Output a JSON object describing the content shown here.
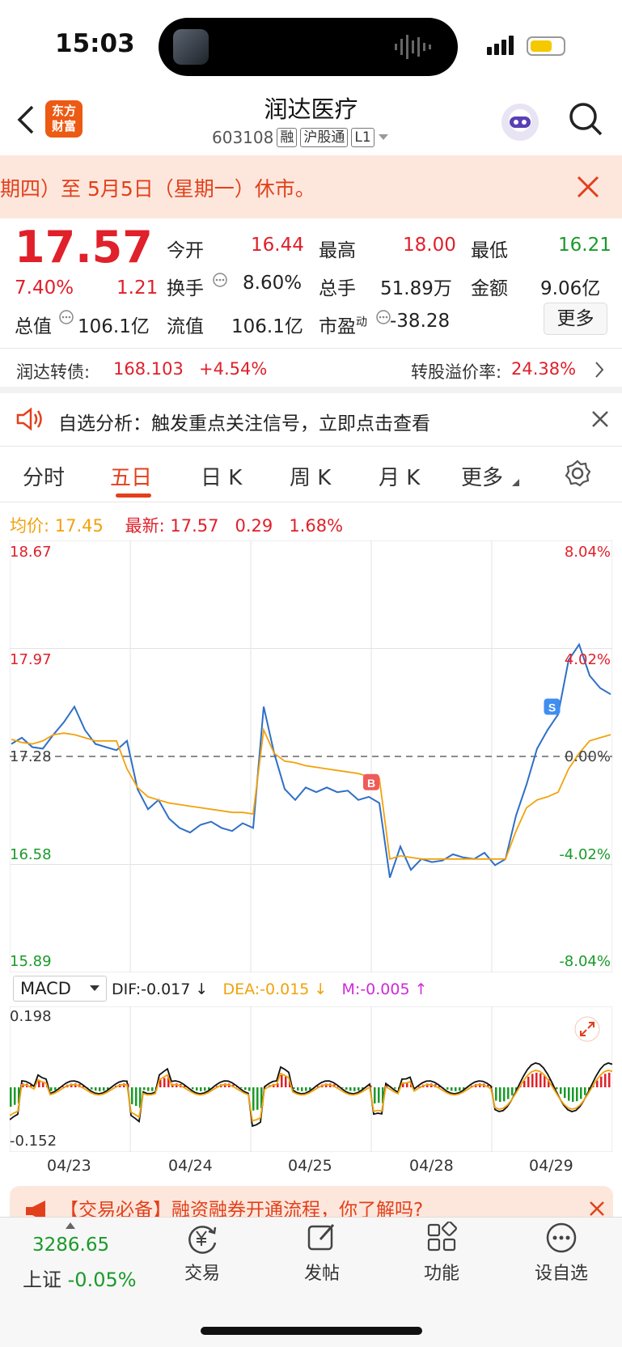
{
  "status": {
    "time": "15:03"
  },
  "header": {
    "logo": "东方\n财富",
    "title": "润达医疗",
    "code": "603108",
    "tags": [
      "融",
      "沪股通",
      "L1"
    ]
  },
  "notice": {
    "text": "期四）至 5月5日（星期一）休市。"
  },
  "quote": {
    "price": "17.57",
    "change_pct": "7.40%",
    "change": "1.21",
    "open_label": "今开",
    "open": "16.44",
    "high_label": "最高",
    "high": "18.00",
    "low_label": "最低",
    "low": "16.21",
    "turnover_label": "换手",
    "turnover": "8.60%",
    "volume_label": "总手",
    "volume": "51.89万",
    "amount_label": "金额",
    "amount": "9.06亿",
    "mktcap_label": "总值",
    "mktcap": "106.1亿",
    "float_label": "流值",
    "float": "106.1亿",
    "pe_label": "市盈",
    "pe_sup": "动",
    "pe": "-38.28",
    "more": "更多"
  },
  "bond": {
    "name": "润达转债:",
    "price": "168.103",
    "change": "+4.54%",
    "premium_label": "转股溢价率:",
    "premium": "24.38%"
  },
  "analysis": {
    "text": "自选分析：触发重点关注信号，立即点击查看"
  },
  "tabs": [
    "分时",
    "五日",
    "日 K",
    "周 K",
    "月 K",
    "更多"
  ],
  "chart_legend": {
    "avg_label": "均价:",
    "avg": "17.45",
    "latest_label": "最新:",
    "latest": "17.57",
    "chg": "0.29",
    "chg_pct": "1.68%"
  },
  "chart_data": {
    "type": "line",
    "title": "",
    "days": [
      "04/23",
      "04/24",
      "04/25",
      "04/28",
      "04/29"
    ],
    "ylim": [
      15.89,
      18.67
    ],
    "y_ticks_left": [
      "18.67",
      "17.97",
      "17.28",
      "16.58",
      "15.89"
    ],
    "y_ticks_right": [
      "8.04%",
      "4.02%",
      "0.00%",
      "-4.02%",
      "-8.04%"
    ],
    "baseline": 17.28,
    "series": [
      {
        "values": [
          17.36,
          17.4,
          17.34,
          17.33,
          17.42,
          17.5,
          17.6,
          17.45,
          17.36,
          17.34,
          17.32,
          17.38,
          17.07,
          16.94,
          17.0,
          16.88,
          16.82,
          16.79,
          16.84,
          16.86,
          16.82,
          16.8,
          16.85,
          16.82,
          17.6,
          17.3,
          17.07,
          17.0,
          17.08,
          17.05,
          17.08,
          17.05,
          17.06,
          17.0,
          17.02,
          16.98,
          16.5,
          16.7,
          16.55,
          16.62,
          16.6,
          16.61,
          16.65,
          16.63,
          16.62,
          16.66,
          16.58,
          16.62,
          16.9,
          17.1,
          17.33,
          17.45,
          17.55,
          17.9,
          18.0,
          17.8,
          17.72,
          17.68
        ]
      },
      {
        "values": [
          17.39,
          17.37,
          17.36,
          17.38,
          17.42,
          17.43,
          17.42,
          17.4,
          17.38,
          17.38,
          17.38,
          17.2,
          17.08,
          17.02,
          17.0,
          16.98,
          16.97,
          16.96,
          16.95,
          16.94,
          16.93,
          16.92,
          16.92,
          16.91,
          17.45,
          17.3,
          17.25,
          17.24,
          17.22,
          17.21,
          17.2,
          17.19,
          17.18,
          17.17,
          17.15,
          17.14,
          16.62,
          16.64,
          16.63,
          16.62,
          16.62,
          16.62,
          16.62,
          16.62,
          16.62,
          16.62,
          16.62,
          16.62,
          16.8,
          16.95,
          17.0,
          17.02,
          17.05,
          17.2,
          17.3,
          17.38,
          17.4,
          17.42
        ]
      }
    ],
    "markers": [
      "B",
      "S"
    ]
  },
  "macd": {
    "label": "MACD",
    "dif": "DIF:-0.017 ↓",
    "dea": "DEA:-0.015 ↓",
    "m": "M:-0.005 ↑",
    "ylim": [
      -0.152,
      0.198
    ],
    "y_top": "0.198",
    "y_bottom": "-0.152"
  },
  "banner": {
    "text": "【交易必备】融资融券开通流程，你了解吗?"
  },
  "bottom": {
    "index_value": "3286.65",
    "index_name": "上证",
    "index_change": "-0.05%",
    "items": [
      "交易",
      "发帖",
      "功能",
      "设自选"
    ]
  }
}
